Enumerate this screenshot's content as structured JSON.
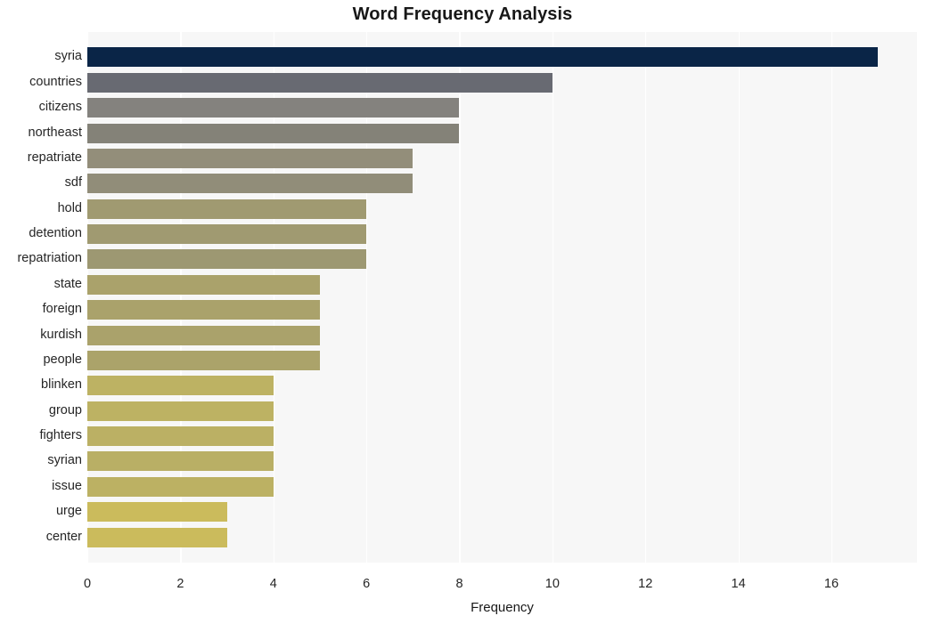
{
  "chart_data": {
    "type": "bar",
    "orientation": "horizontal",
    "title": "Word Frequency Analysis",
    "xlabel": "Frequency",
    "ylabel": "",
    "categories": [
      "syria",
      "countries",
      "citizens",
      "northeast",
      "repatriate",
      "sdf",
      "hold",
      "detention",
      "repatriation",
      "state",
      "foreign",
      "kurdish",
      "people",
      "blinken",
      "group",
      "fighters",
      "syrian",
      "issue",
      "urge",
      "center"
    ],
    "values": [
      17,
      10,
      8,
      8,
      7,
      7,
      6,
      6,
      6,
      5,
      5,
      5,
      5,
      4,
      4,
      4,
      4,
      4,
      3,
      3
    ],
    "xlim": [
      0,
      17.84
    ],
    "ylim_categories": 20,
    "xticks": [
      0,
      2,
      4,
      6,
      8,
      10,
      12,
      14,
      16
    ],
    "xtick_labels": [
      "0",
      "2",
      "4",
      "6",
      "8",
      "10",
      "12",
      "14",
      "16"
    ],
    "grid": true,
    "grid_axis": "x",
    "grid_color": "#ffffff",
    "legend": false,
    "legend_position": "none",
    "plot_background": "#f7f7f7",
    "figure_background": "#ffffff",
    "bar_colors": [
      "#0a2547",
      "#686a72",
      "#84827e",
      "#848278",
      "#938e7a",
      "#918d79",
      "#a09a71",
      "#a09a71",
      "#9d9872",
      "#aaa26b",
      "#aaa26b",
      "#aaa26b",
      "#aba36a",
      "#bdb263",
      "#bdb263",
      "#bbb064",
      "#b9af65",
      "#bcb163",
      "#cbbb5c",
      "#cbbb5c"
    ]
  },
  "axis": {
    "x_title": "Frequency"
  }
}
